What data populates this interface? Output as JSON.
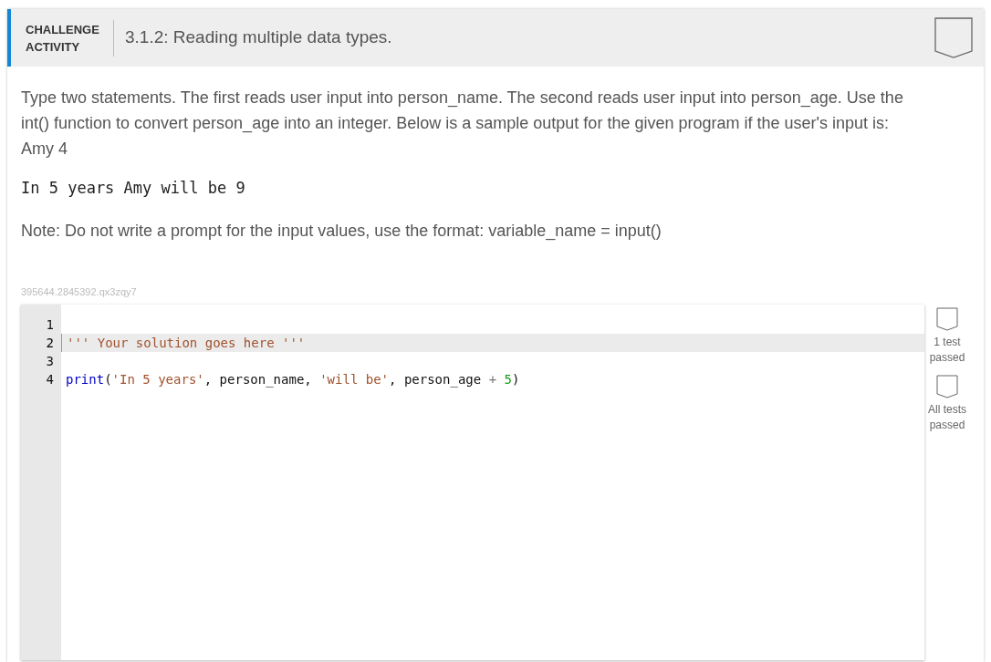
{
  "header": {
    "label": "CHALLENGE ACTIVITY",
    "title": "3.1.2: Reading multiple data types."
  },
  "instructions": "Type two statements. The first reads user input into person_name. The second reads user input into person_age. Use the int() function to convert person_age into an integer. Below is a sample output for the given program if the user's input is: Amy 4",
  "sample_output": "In 5 years Amy will be 9",
  "note": "Note: Do not write a prompt for the input values, use the format: variable_name = input()",
  "activity_id": "395644.2845392.qx3zqy7",
  "editor": {
    "lines": [
      {
        "number": "1",
        "active": false
      },
      {
        "number": "2",
        "active": true,
        "tokens": [
          {
            "kind": "string",
            "text": "''' Your solution goes here '''"
          }
        ]
      },
      {
        "number": "3",
        "active": false
      },
      {
        "number": "4",
        "active": false,
        "tokens": [
          {
            "kind": "builtin",
            "text": "print"
          },
          {
            "kind": "plain",
            "text": "("
          },
          {
            "kind": "string",
            "text": "'In 5 years'"
          },
          {
            "kind": "plain",
            "text": ", person_name, "
          },
          {
            "kind": "string",
            "text": "'will be'"
          },
          {
            "kind": "plain",
            "text": ", person_age "
          },
          {
            "kind": "operator",
            "text": "+"
          },
          {
            "kind": "number",
            "text": " 5"
          },
          {
            "kind": "plain",
            "text": ")"
          }
        ]
      }
    ]
  },
  "progress": [
    {
      "label": "1 test passed",
      "done": false
    },
    {
      "label": "All tests passed",
      "done": false
    }
  ]
}
